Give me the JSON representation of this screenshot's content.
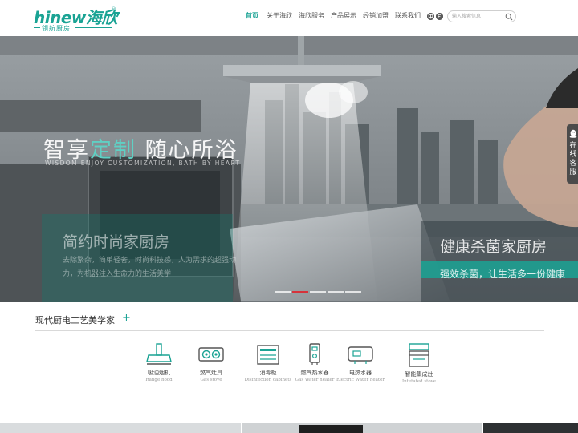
{
  "brand": {
    "logo_text": "hinew海欣",
    "registered_mark": "®",
    "tagline": "领航厨房",
    "color": "#1aa394"
  },
  "nav": {
    "items": [
      {
        "label": "首页",
        "active": true
      },
      {
        "label": "关于海欣",
        "active": false
      },
      {
        "label": "海欣服务",
        "active": false
      },
      {
        "label": "产品展示",
        "active": false
      },
      {
        "label": "经销加盟",
        "active": false
      },
      {
        "label": "联系我们",
        "active": false
      }
    ]
  },
  "language": {
    "items": [
      {
        "icon": "chinese-language-icon"
      },
      {
        "icon": "english-language-icon"
      }
    ]
  },
  "search": {
    "placeholder": "输入搜索信息",
    "icon": "search-icon"
  },
  "hero": {
    "slide_main": {
      "title_prefix": "智享",
      "title_accent": "定制",
      "title_suffix": " 随心所浴",
      "subtitle": "WISDOM ENJOY CUSTOMIZATION, BATH BY HEART"
    },
    "slide_left": {
      "title": "简约时尚家厨房",
      "text": "去除繁杂，简单轻奢，时尚科技感，人为需求的超强动力，为机器注入生命力的生活美学"
    },
    "slide_right": {
      "title": "健康杀菌家厨房",
      "subtitle": "强效杀菌，让生活多一份健康"
    },
    "pagination": {
      "count": 5,
      "active_index": 1
    },
    "accent_color": "#5fd0c4"
  },
  "online_service": {
    "label": "在线客服",
    "icon": "qq-penguin-icon"
  },
  "products_section": {
    "title": "现代厨电工艺美学家",
    "plus": "+",
    "categories": [
      {
        "cn": "吸油烟机",
        "en": "Range hood",
        "icon": "range-hood-icon"
      },
      {
        "cn": "燃气灶具",
        "en": "Gas stove",
        "icon": "gas-stove-icon"
      },
      {
        "cn": "消毒柜",
        "en": "Disinfection cabinets",
        "icon": "disinfection-cabinet-icon"
      },
      {
        "cn": "燃气热水器",
        "en": "Gas Water heater",
        "icon": "gas-water-heater-icon"
      },
      {
        "cn": "电热水器",
        "en": "Electric Water heater",
        "icon": "electric-water-heater-icon"
      },
      {
        "cn": "智能集成灶",
        "en": "Intetated stove",
        "icon": "integrated-stove-icon"
      }
    ]
  }
}
